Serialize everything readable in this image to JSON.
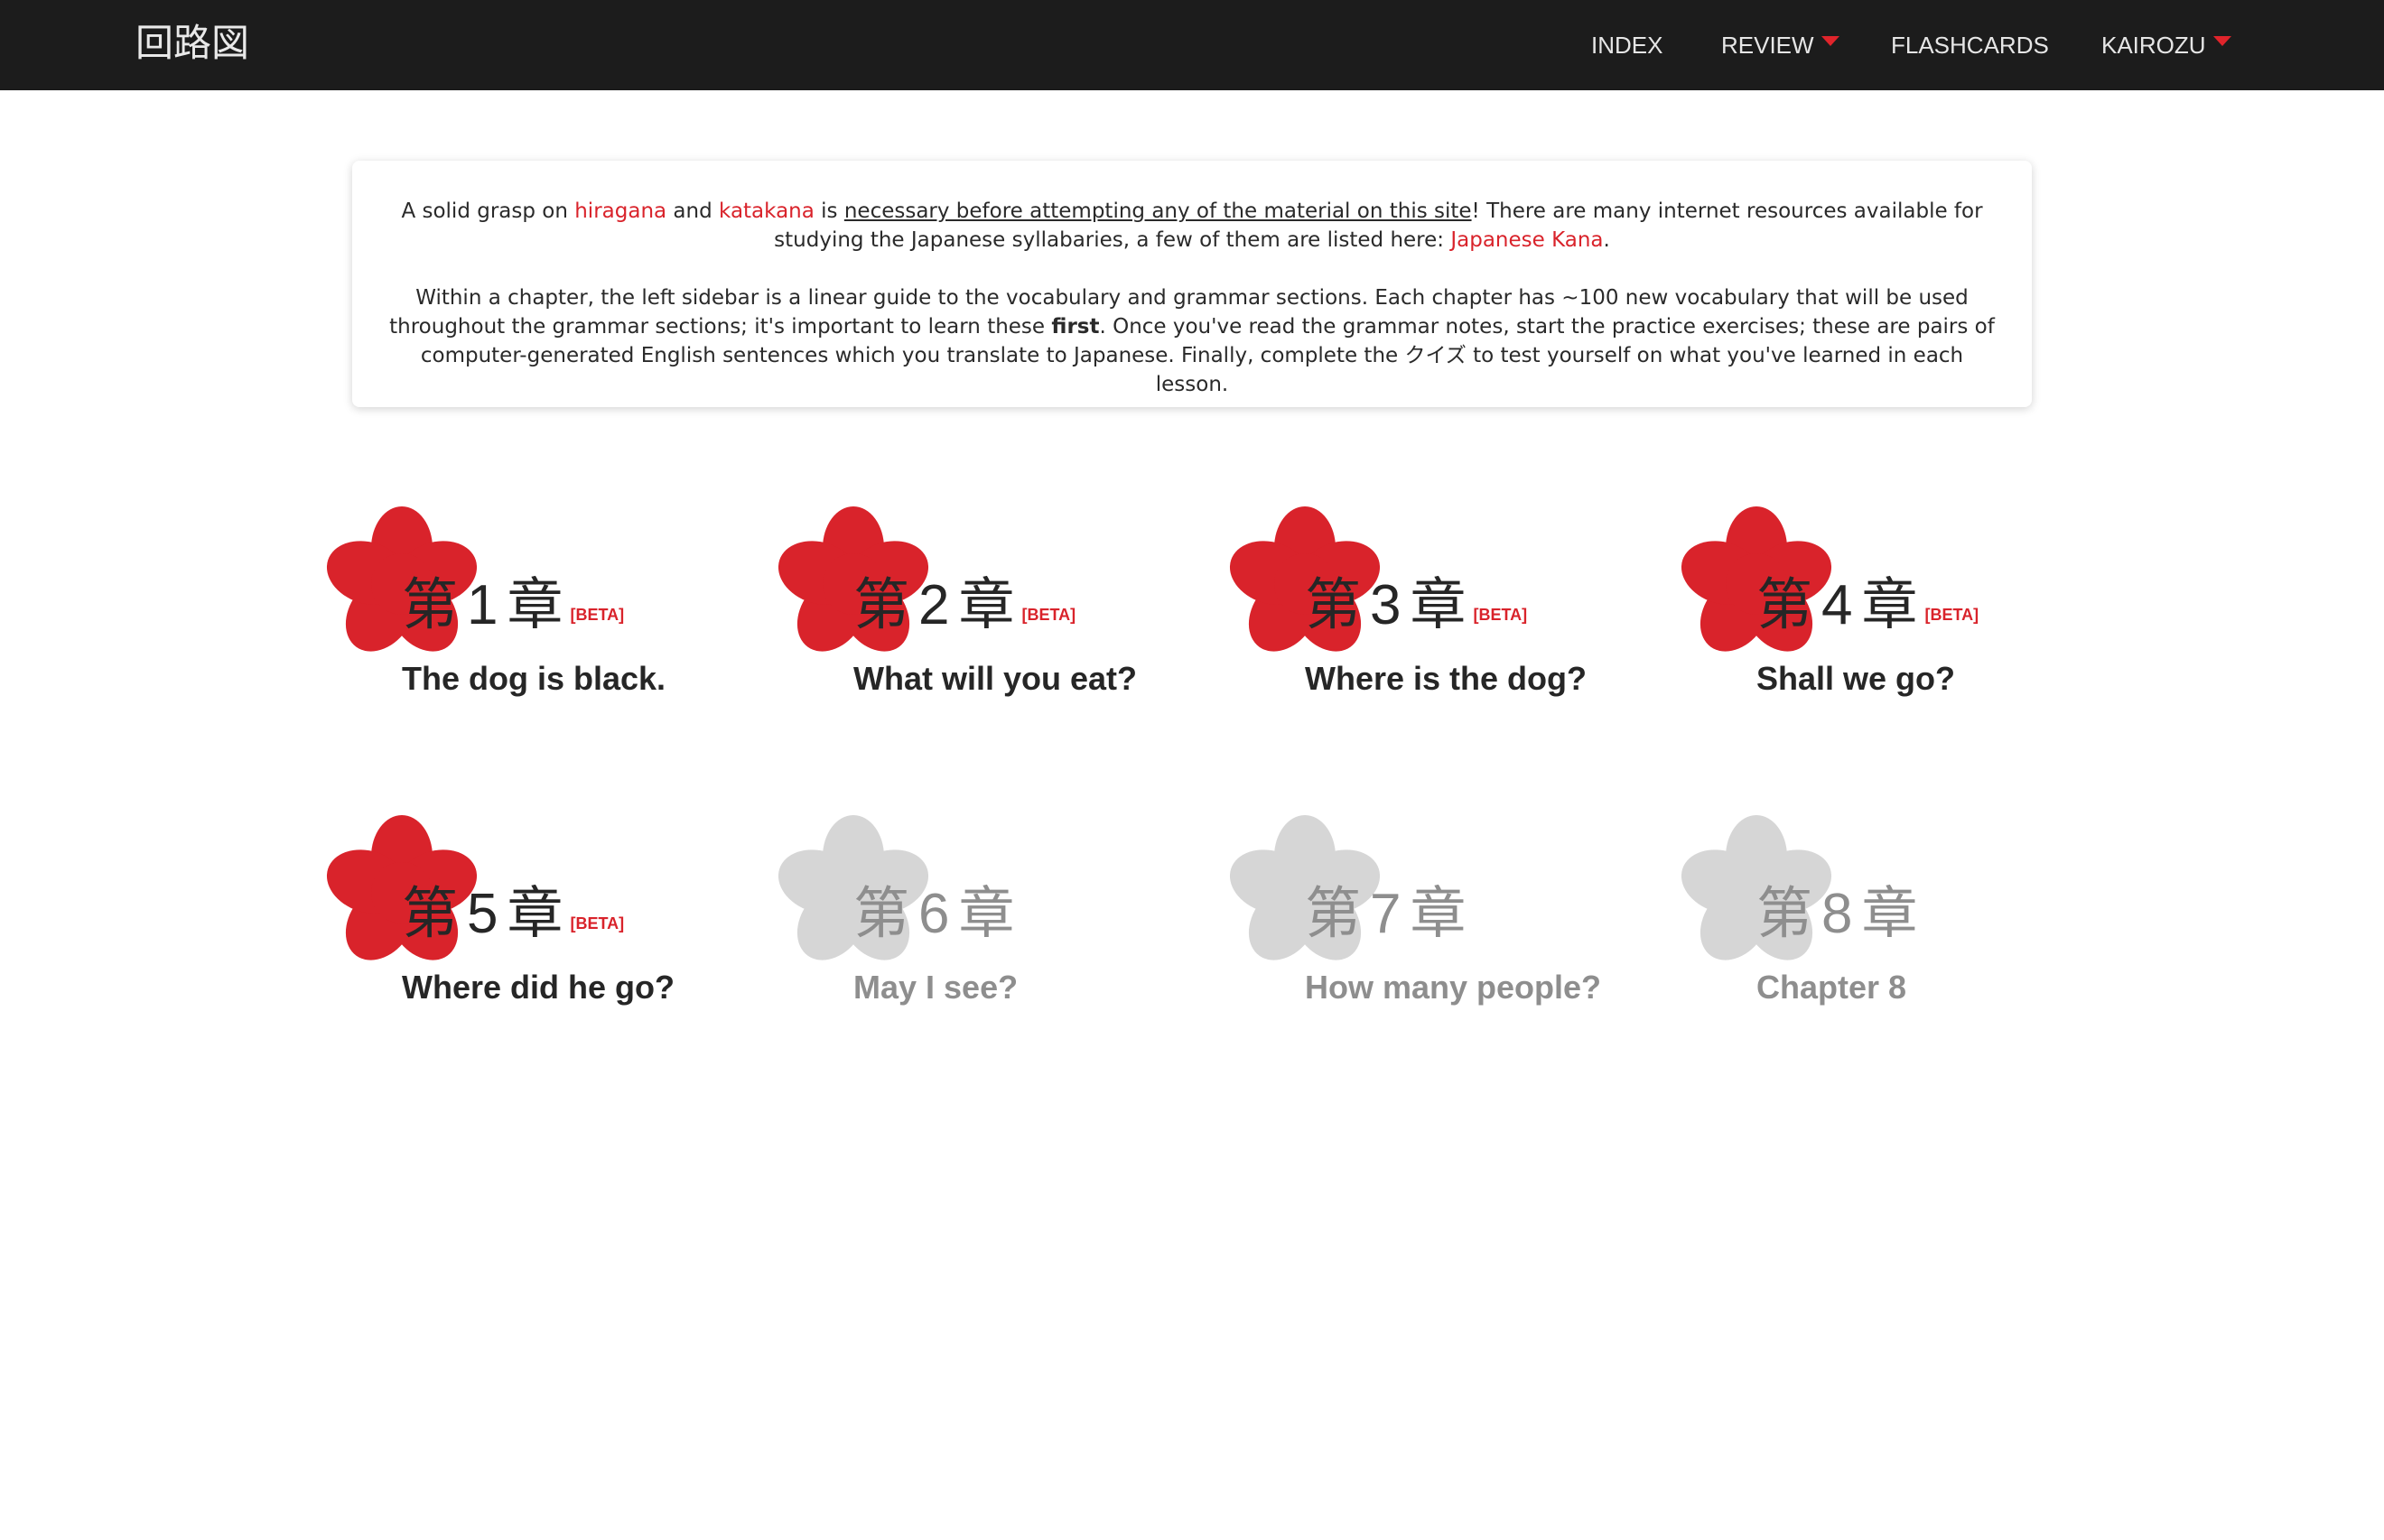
{
  "nav": {
    "brand": "回路図",
    "items": [
      {
        "label": "INDEX",
        "has_caret": false
      },
      {
        "label": "REVIEW",
        "has_caret": true
      },
      {
        "label": "FLASHCARDS",
        "has_caret": false
      },
      {
        "label": "KAIROZU",
        "has_caret": true
      }
    ],
    "caret_color": "#e0242b"
  },
  "intro": {
    "p1": {
      "t1": "A solid grasp on ",
      "hiragana": "hiragana",
      "t2": " and ",
      "katakana": "katakana",
      "t3": " is ",
      "underlined": "necessary before attempting any of the material on this site",
      "t4": "! There are many internet resources available for studying the Japanese syllabaries, a few of them are listed here: ",
      "kana_link": "Japanese Kana",
      "t5": "."
    },
    "p2": {
      "t1": "Within a chapter, the left sidebar is a linear guide to the vocabulary and grammar sections. Each chapter has ~100 new vocabulary that will be used throughout the grammar sections; it's important to learn these ",
      "bold": "first",
      "t2": ". Once you've read the grammar notes, start the practice exercises; these are pairs of computer-generated English sentences which you translate to Japanese. Finally, complete the ",
      "quiz": "クイズ",
      "t3": " to test yourself on what you've learned in each lesson."
    }
  },
  "chapter_prefix": "第",
  "chapter_suffix": "章",
  "beta_label": "[BETA]",
  "colors": {
    "accent": "#d9232b",
    "flower_active": "#d9232b",
    "flower_locked": "#d6d6d6",
    "nav_bg": "#1c1c1c"
  },
  "chapters": [
    {
      "number": "1",
      "title": "The dog is black.",
      "status": "active",
      "beta": true
    },
    {
      "number": "2",
      "title": "What will you eat?",
      "status": "active",
      "beta": true
    },
    {
      "number": "3",
      "title": "Where is the dog?",
      "status": "active",
      "beta": true
    },
    {
      "number": "4",
      "title": "Shall we go?",
      "status": "active",
      "beta": true
    },
    {
      "number": "5",
      "title": "Where did he go?",
      "status": "active",
      "beta": true
    },
    {
      "number": "6",
      "title": "May I see?",
      "status": "locked",
      "beta": false
    },
    {
      "number": "7",
      "title": "How many people?",
      "status": "locked",
      "beta": false
    },
    {
      "number": "8",
      "title": "Chapter 8",
      "status": "locked",
      "beta": false
    }
  ]
}
